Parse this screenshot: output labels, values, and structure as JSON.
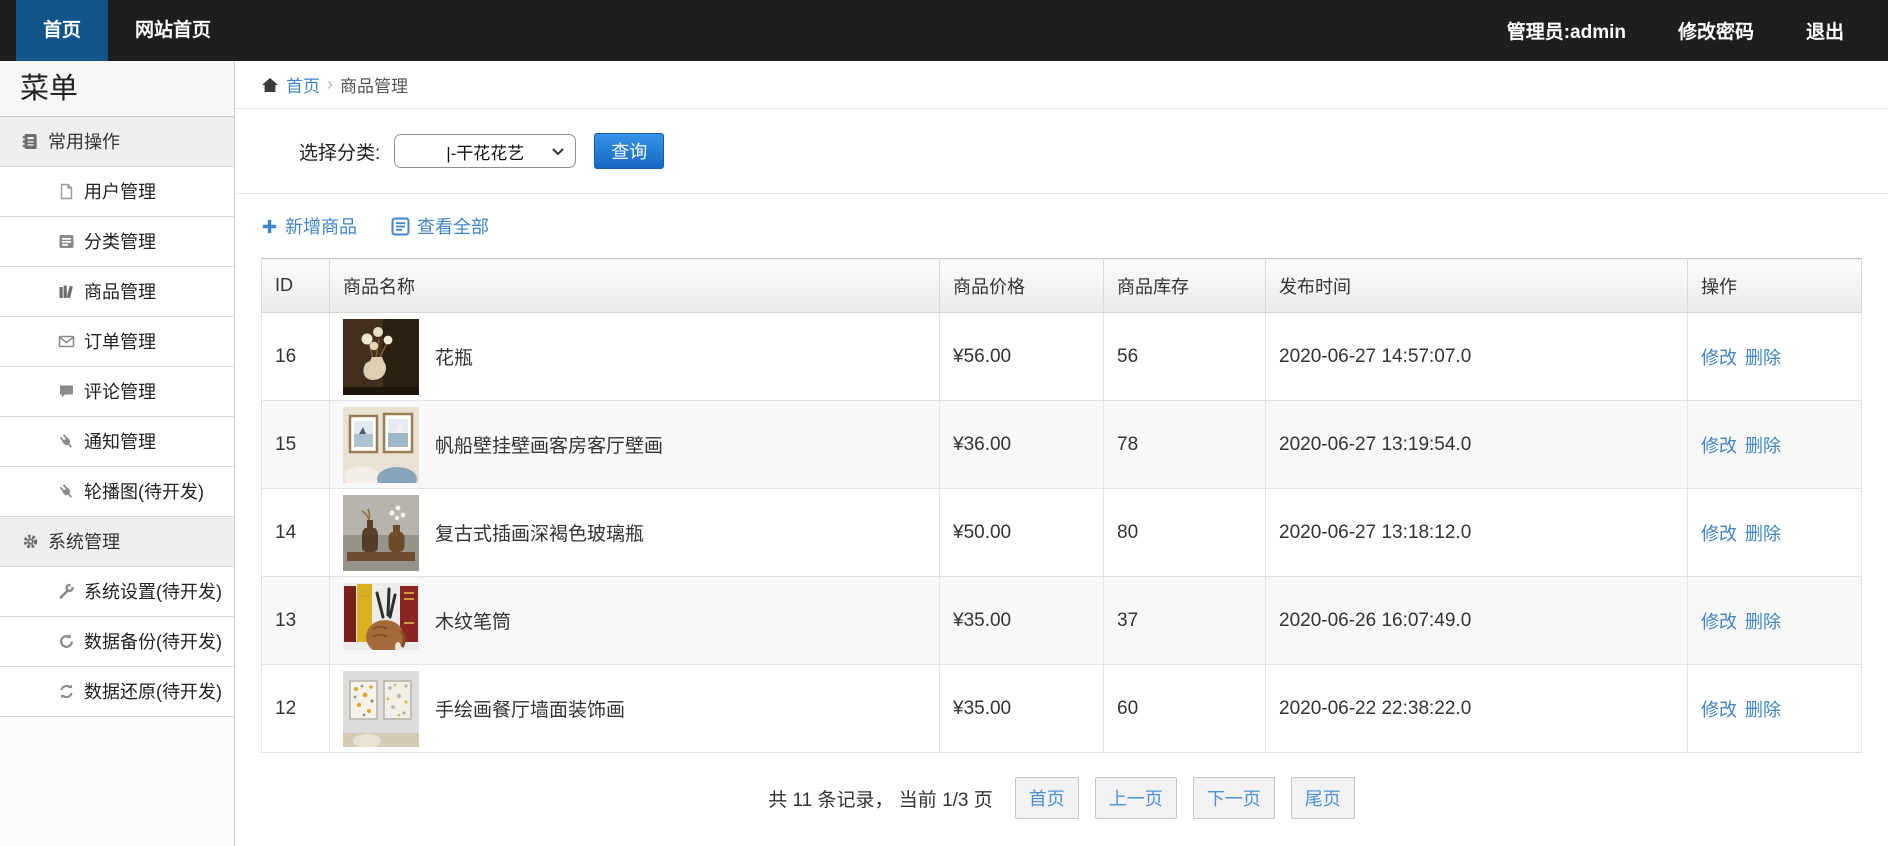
{
  "navbar": {
    "tabs": [
      {
        "name": "home",
        "label": "首页",
        "active": true
      },
      {
        "name": "site-home",
        "label": "网站首页",
        "active": false
      }
    ],
    "user_label": "管理员:admin",
    "change_password": "修改密码",
    "logout": "退出"
  },
  "sidebar": {
    "title": "菜单",
    "groups": [
      {
        "name": "common",
        "label": "常用操作",
        "icon": "address-book-icon",
        "items": [
          {
            "label": "用户管理",
            "icon": "file-icon"
          },
          {
            "label": "分类管理",
            "icon": "list-alt-icon"
          },
          {
            "label": "商品管理",
            "icon": "books-icon"
          },
          {
            "label": "订单管理",
            "icon": "envelope-icon"
          },
          {
            "label": "评论管理",
            "icon": "comment-icon"
          },
          {
            "label": "通知管理",
            "icon": "plug-icon"
          },
          {
            "label": "轮播图(待开发)",
            "icon": "plug-icon"
          }
        ]
      },
      {
        "name": "system",
        "label": "系统管理",
        "icon": "gear-icon",
        "items": [
          {
            "label": "系统设置(待开发)",
            "icon": "wrench-icon"
          },
          {
            "label": "数据备份(待开发)",
            "icon": "redo-icon"
          },
          {
            "label": "数据还原(待开发)",
            "icon": "sync-icon"
          }
        ]
      }
    ]
  },
  "breadcrumb": {
    "home": "首页",
    "current": "商品管理"
  },
  "filter": {
    "label": "选择分类:",
    "selected_option": "|-干花花艺",
    "search_button": "查询"
  },
  "actions": {
    "add": "新增商品",
    "view_all": "查看全部"
  },
  "table": {
    "headers": [
      "ID",
      "商品名称",
      "商品价格",
      "商品库存",
      "发布时间",
      "操作"
    ],
    "edit_label": "修改",
    "delete_label": "删除",
    "rows": [
      {
        "id": "16",
        "name": "花瓶",
        "price": "¥56.00",
        "stock": "56",
        "time": "2020-06-27 14:57:07.0",
        "thumb": "vase"
      },
      {
        "id": "15",
        "name": "帆船壁挂壁画客房客厅壁画",
        "price": "¥36.00",
        "stock": "78",
        "time": "2020-06-27 13:19:54.0",
        "thumb": "paintings"
      },
      {
        "id": "14",
        "name": "复古式插画深褐色玻璃瓶",
        "price": "¥50.00",
        "stock": "80",
        "time": "2020-06-27 13:18:12.0",
        "thumb": "bottles"
      },
      {
        "id": "13",
        "name": "木纹笔筒",
        "price": "¥35.00",
        "stock": "37",
        "time": "2020-06-26 16:07:49.0",
        "thumb": "penholder"
      },
      {
        "id": "12",
        "name": "手绘画餐厅墙面装饰画",
        "price": "¥35.00",
        "stock": "60",
        "time": "2020-06-22 22:38:22.0",
        "thumb": "abstract"
      }
    ]
  },
  "pagination": {
    "summary": "共 11 条记录， 当前 1/3 页",
    "buttons": [
      "首页",
      "上一页",
      "下一页",
      "尾页"
    ]
  },
  "colors": {
    "navbar_bg": "#1e1e1e",
    "active_tab_blue": "#0f548a",
    "link_blue": "#3f86c9",
    "button_blue_top": "#3794e8",
    "button_blue_bottom": "#1767c4",
    "pagination_link_blue": "#4a90d9"
  }
}
